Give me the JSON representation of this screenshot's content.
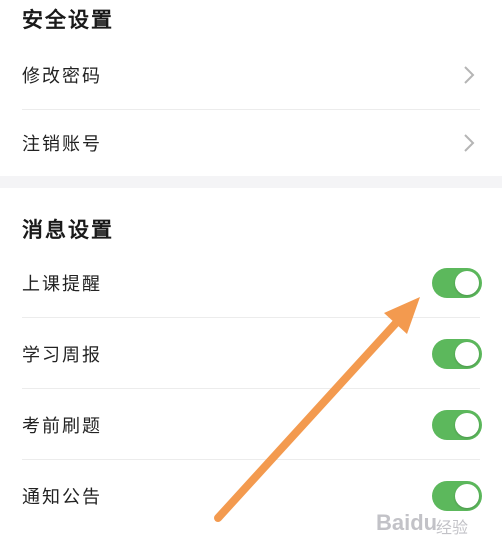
{
  "security": {
    "title": "安全设置",
    "items": [
      {
        "label": "修改密码"
      },
      {
        "label": "注销账号"
      }
    ]
  },
  "message": {
    "title": "消息设置",
    "items": [
      {
        "label": "上课提醒",
        "enabled": true
      },
      {
        "label": "学习周报",
        "enabled": true
      },
      {
        "label": "考前刷题",
        "enabled": true
      },
      {
        "label": "通知公告",
        "enabled": true
      }
    ]
  },
  "watermark": {
    "brand": "Baidu",
    "sub": "经验"
  },
  "colors": {
    "toggle_on": "#5cb85c",
    "arrow": "#f39a4f",
    "divider": "#ececec"
  }
}
